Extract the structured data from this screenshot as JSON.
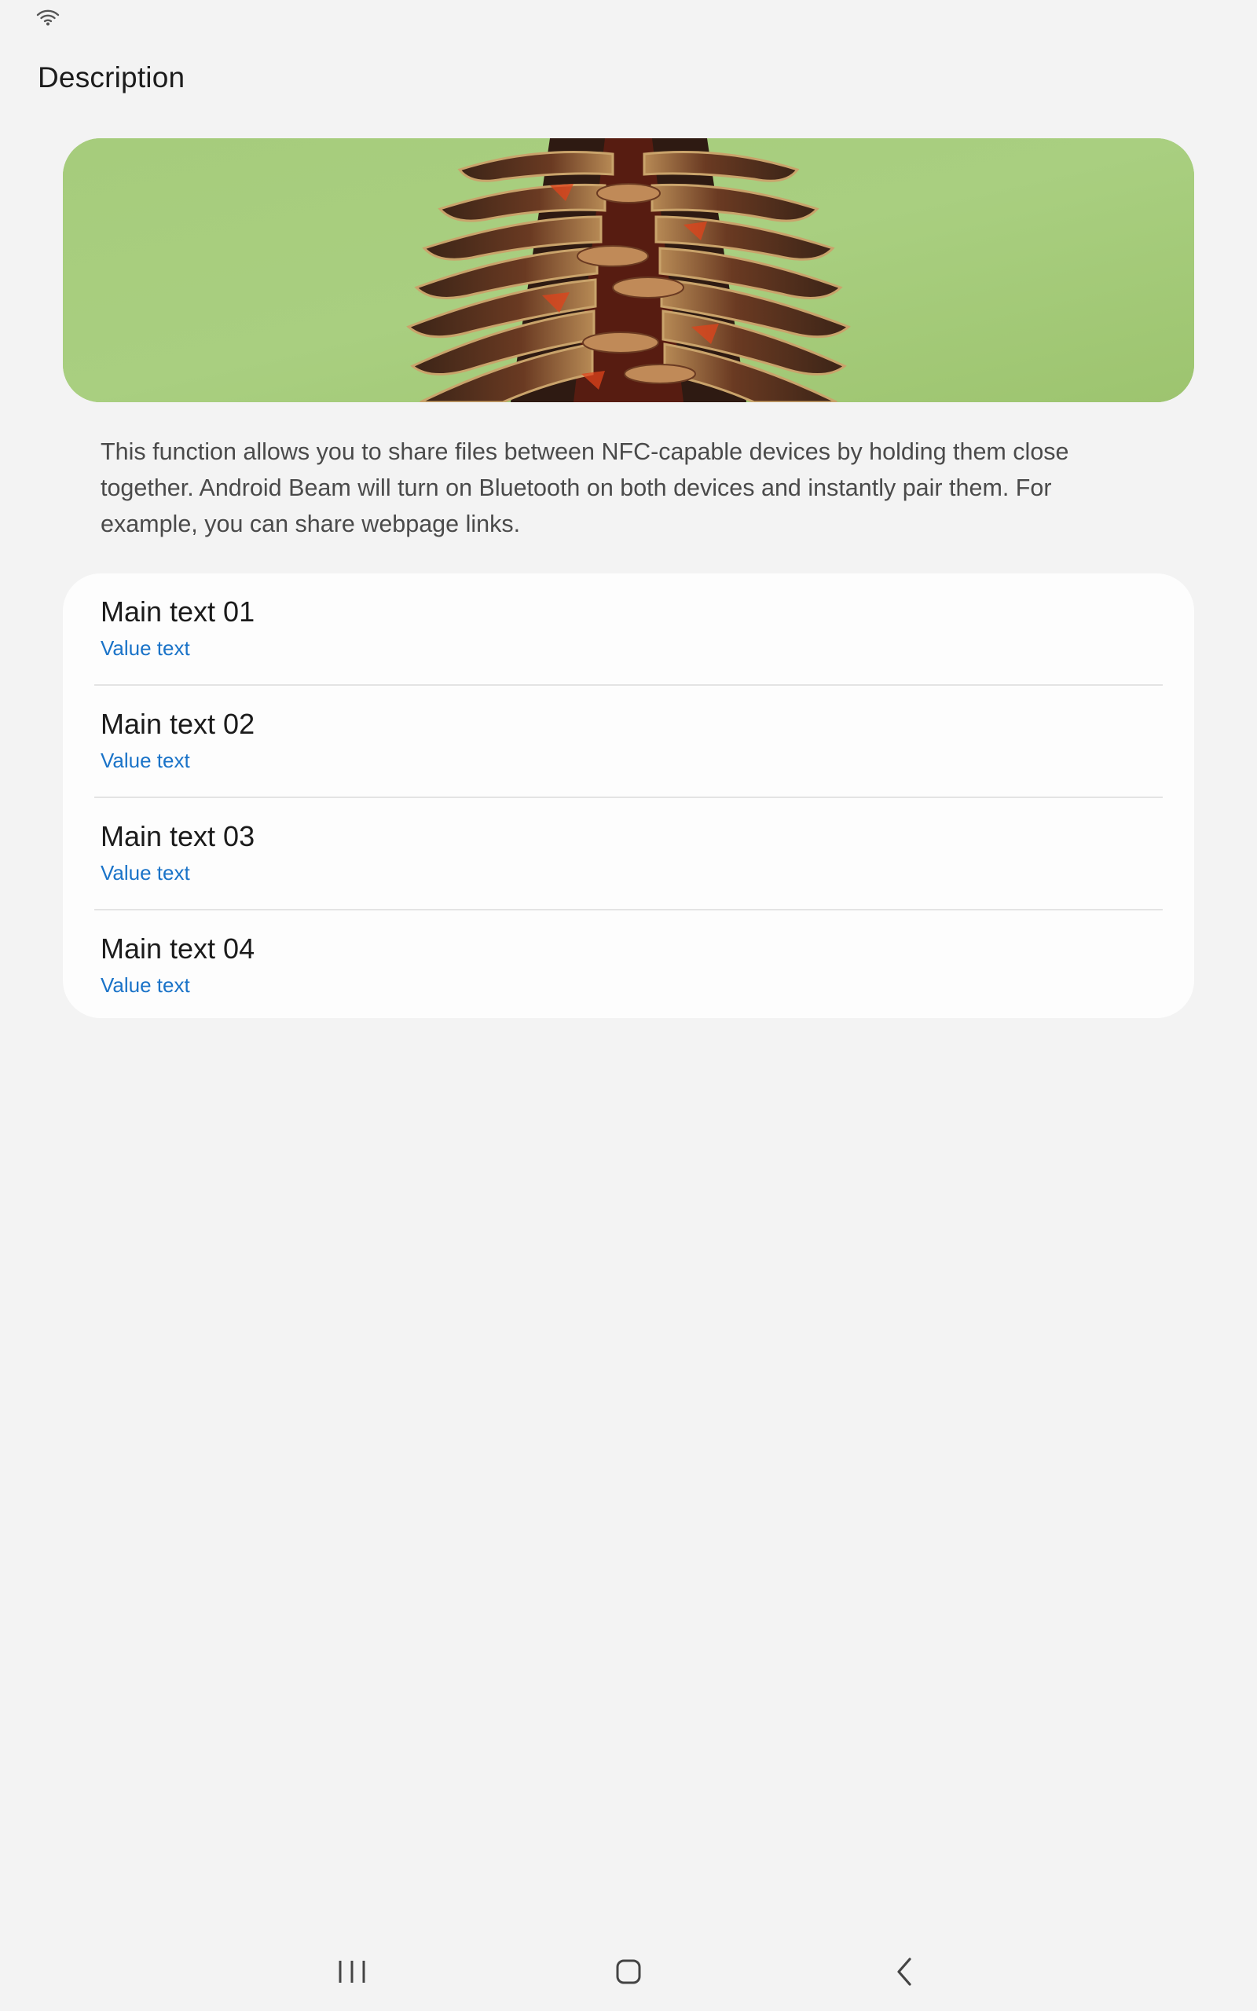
{
  "status_bar": {
    "icons": [
      "wifi-icon"
    ]
  },
  "header": {
    "title": "Description"
  },
  "hero_image": {
    "subject": "pine-cone-image",
    "background_color": "#a3c97a"
  },
  "description": {
    "text": "This function allows you to share files between NFC-capable devices by holding them close together. Android Beam will  turn on Bluetooth on both devices and instantly pair them. For example, you can share webpage links."
  },
  "list": {
    "items": [
      {
        "main": "Main text 01",
        "value": "Value text"
      },
      {
        "main": "Main text 02",
        "value": "Value text"
      },
      {
        "main": "Main text 03",
        "value": "Value text"
      },
      {
        "main": "Main text 04",
        "value": "Value text"
      }
    ]
  },
  "nav_bar": {
    "buttons": [
      "recent-apps-icon",
      "home-icon",
      "back-icon"
    ]
  },
  "colors": {
    "background": "#f3f3f3",
    "card": "#fdfdfd",
    "value_text": "#1a73c8",
    "primary_text": "#1b1b1b"
  }
}
